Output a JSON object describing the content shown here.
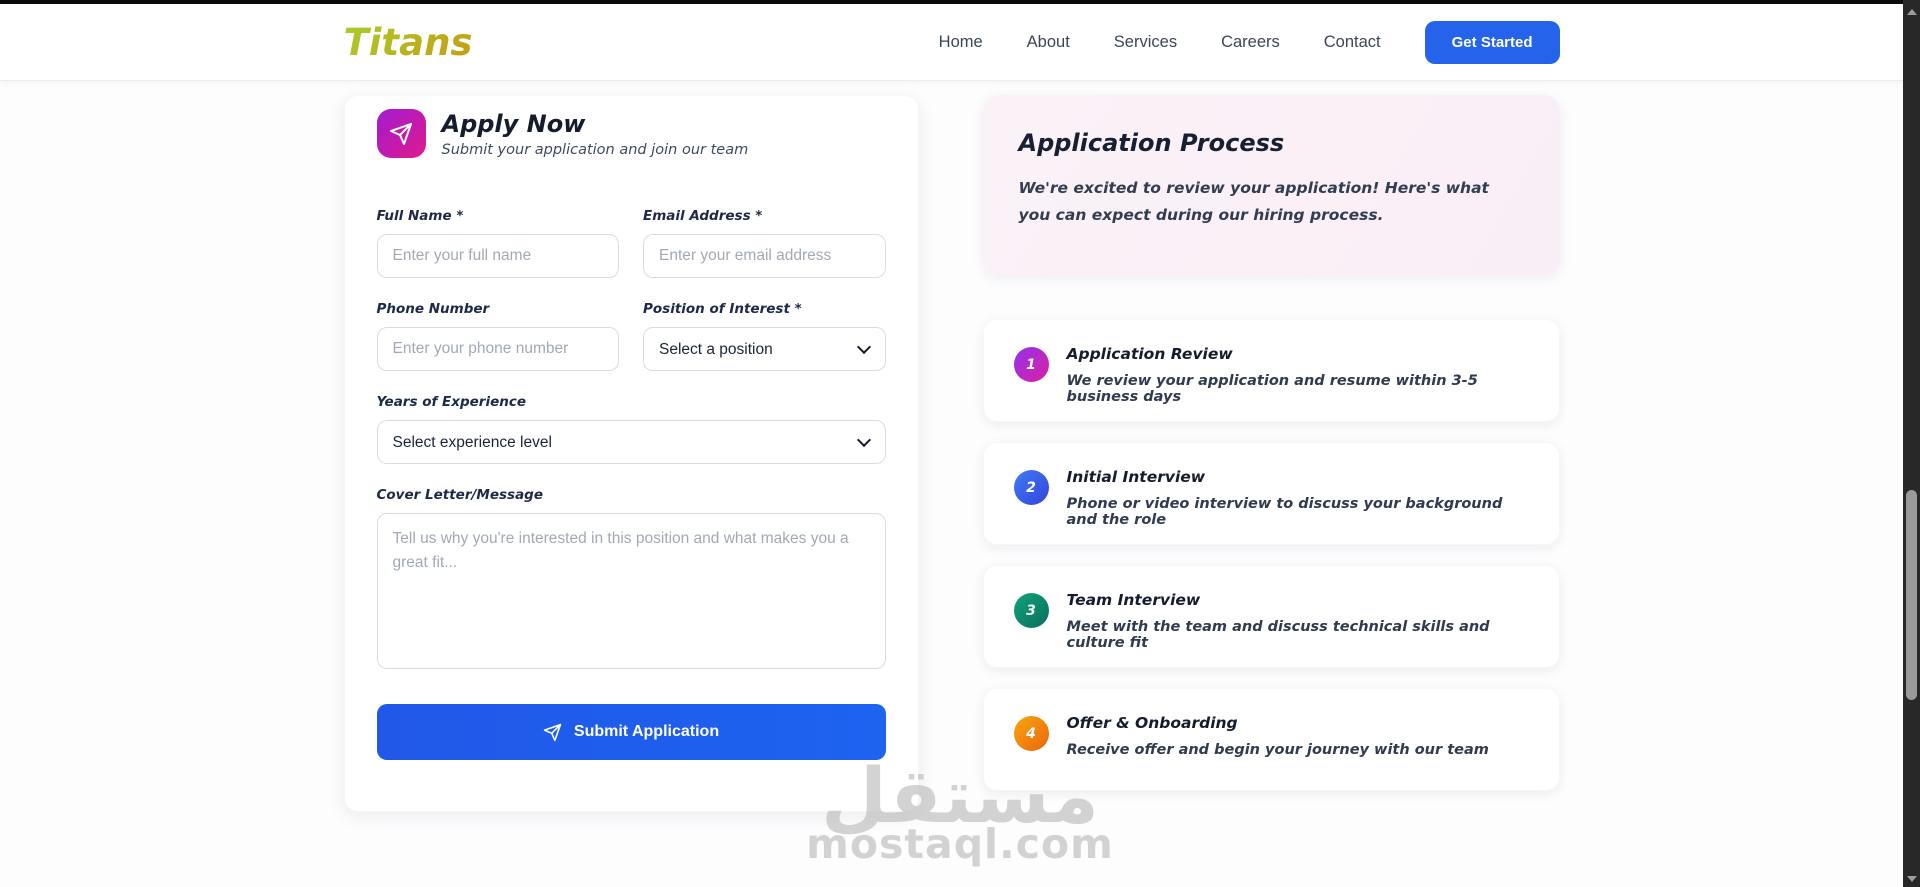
{
  "header": {
    "logo": "Titans",
    "logo_gradient": [
      "#a9cd2d",
      "#c79c10"
    ],
    "nav": {
      "home": "Home",
      "about": "About",
      "services": "Services",
      "careers": "Careers",
      "contact": "Contact"
    },
    "cta_label": "Get Started",
    "accent_color": "#2563eb"
  },
  "form": {
    "title": "Apply Now",
    "subtitle": "Submit your application and join our team",
    "icon": "send-icon",
    "icon_gradient": [
      "#a21cd0",
      "#e0198e"
    ],
    "fields": {
      "full_name": {
        "label": "Full Name *",
        "placeholder": "Enter your full name"
      },
      "email": {
        "label": "Email Address *",
        "placeholder": "Enter your email address"
      },
      "phone": {
        "label": "Phone Number",
        "placeholder": "Enter your phone number"
      },
      "position": {
        "label": "Position of Interest *",
        "selected": "Select a position"
      },
      "experience": {
        "label": "Years of Experience",
        "selected": "Select experience level"
      },
      "cover_letter": {
        "label": "Cover Letter/Message",
        "placeholder": "Tell us why you're interested in this position and what makes you a great fit..."
      }
    },
    "submit_label": "Submit Application",
    "submit_color": "#1f5aeb"
  },
  "process": {
    "title": "Application Process",
    "intro": "We're excited to review your application! Here's what you can expect during our hiring process.",
    "steps": [
      {
        "number": "1",
        "title": "Application Review",
        "description": "We review your application and resume within 3-5 business days",
        "badge_colors": [
          "#9333ea",
          "#db1fa3"
        ]
      },
      {
        "number": "2",
        "title": "Initial Interview",
        "description": "Phone or video interview to discuss your background and the role",
        "badge_colors": [
          "#3f7cf4",
          "#3443dd"
        ]
      },
      {
        "number": "3",
        "title": "Team Interview",
        "description": "Meet with the team and discuss technical skills and culture fit",
        "badge_colors": [
          "#12a37a",
          "#076e5d"
        ]
      },
      {
        "number": "4",
        "title": "Offer & Onboarding",
        "description": "Receive offer and begin your journey with our team",
        "badge_colors": [
          "#f7a70c",
          "#eb650e"
        ]
      }
    ]
  },
  "watermark": {
    "arabic": "مستقل",
    "latin": "mostaql.com"
  }
}
